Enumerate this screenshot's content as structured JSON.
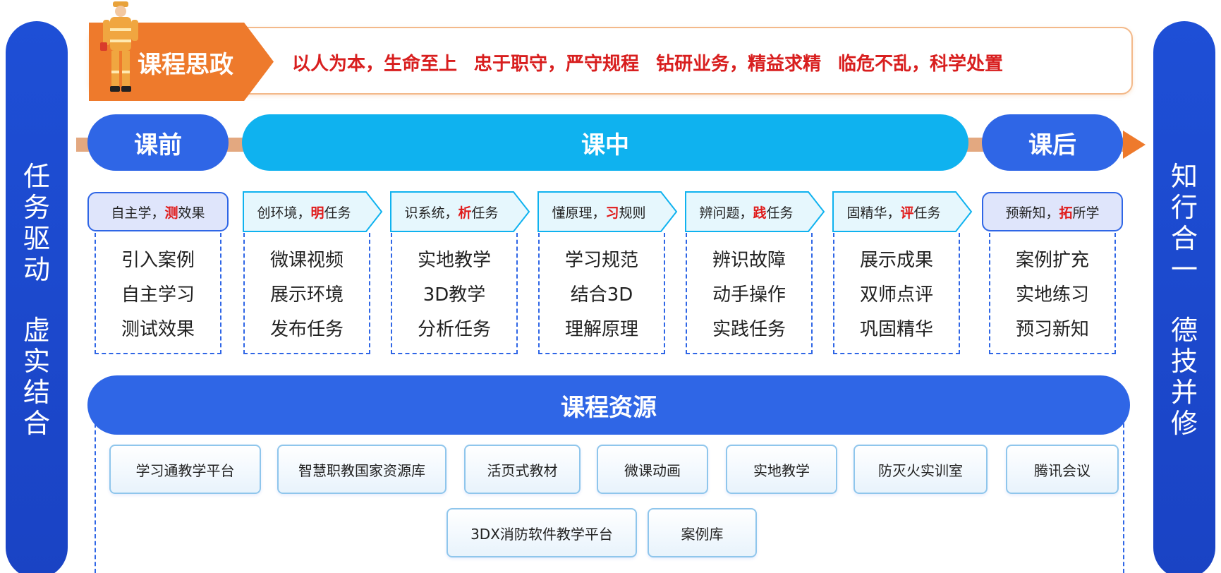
{
  "left_pillar": {
    "line1": [
      "任",
      "务",
      "驱",
      "动"
    ],
    "line2": [
      "虚",
      "实",
      "结",
      "合"
    ]
  },
  "right_pillar": {
    "line1": [
      "知",
      "行",
      "合",
      "一"
    ],
    "line2": [
      "德",
      "技",
      "并",
      "修"
    ]
  },
  "banner": {
    "tag": "课程思政",
    "values": [
      "以人为本，生命至上",
      "忠于职守，严守规程",
      "钻研业务，精益求精",
      "临危不乱，科学处置"
    ]
  },
  "phases": {
    "pre": "课前",
    "mid": "课中",
    "post": "课后"
  },
  "tasks": [
    {
      "a": "自主学，",
      "hl": "测",
      "b": "效果",
      "items": [
        "引入案例",
        "自主学习",
        "测试效果"
      ]
    },
    {
      "a": "创环境，",
      "hl": "明",
      "b": "任务",
      "items": [
        "微课视频",
        "展示环境",
        "发布任务"
      ]
    },
    {
      "a": "识系统，",
      "hl": "析",
      "b": "任务",
      "items": [
        "实地教学",
        "3D教学",
        "分析任务"
      ]
    },
    {
      "a": "懂原理，",
      "hl": "习",
      "b": "规则",
      "items": [
        "学习规范",
        "结合3D",
        "理解原理"
      ]
    },
    {
      "a": "辨问题，",
      "hl": "践",
      "b": "任务",
      "items": [
        "辨识故障",
        "动手操作",
        "实践任务"
      ]
    },
    {
      "a": "固精华，",
      "hl": "评",
      "b": "任务",
      "items": [
        "展示成果",
        "双师点评",
        "巩固精华"
      ]
    },
    {
      "a": "预新知，",
      "hl": "拓",
      "b": "所学",
      "items": [
        "案例扩充",
        "实地练习",
        "预习新知"
      ]
    }
  ],
  "resources": {
    "title": "课程资源",
    "row1": [
      "学习通教学平台",
      "智慧职教国家资源库",
      "活页式教材",
      "微课动画",
      "实地教学",
      "防灭火实训室",
      "腾讯会议"
    ],
    "row2": [
      "3DX消防软件教学平台",
      "案例库"
    ]
  },
  "colors": {
    "pillar": "#1e4fd6",
    "phase_blue": "#2f66e6",
    "phase_cyan": "#0fb2ef",
    "orange": "#ee7a2c",
    "red_text": "#d81e1e"
  }
}
